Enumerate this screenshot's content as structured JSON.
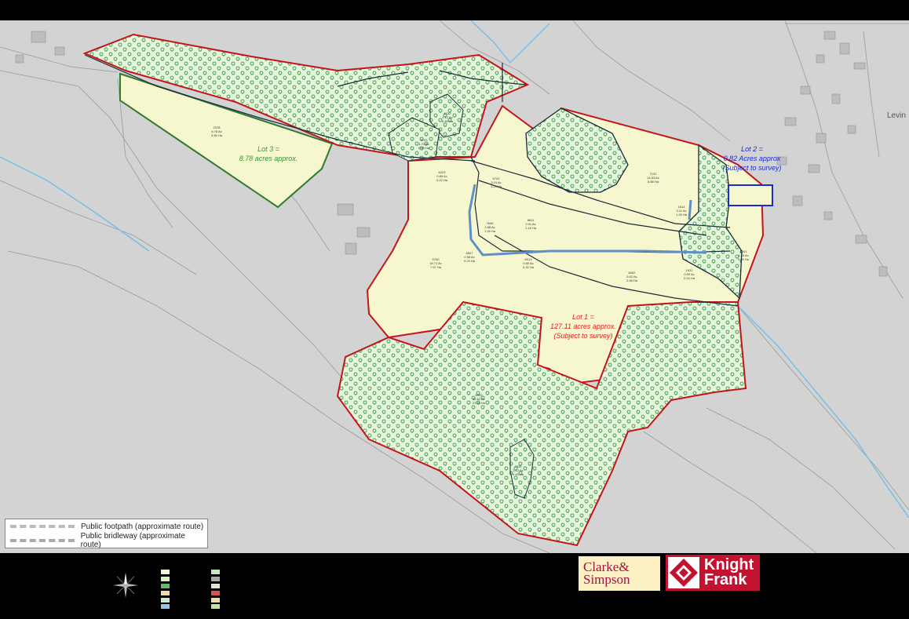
{
  "map": {
    "lots": [
      {
        "name": "lot-1",
        "title": "Lot 1 =",
        "line1": "127.11 acres approx.",
        "line2": "(Subject to survey)",
        "color": "#e0201c"
      },
      {
        "name": "lot-2",
        "title": "Lot 2 =",
        "line1": "0.82 Acres approx",
        "line2": "(Subject to survey)",
        "color": "#1a2bd6"
      },
      {
        "name": "lot-3",
        "title": "Lot 3 =",
        "line1": "8.78 acres approx.",
        "line2": "",
        "color": "#2e9a2e"
      }
    ],
    "plots": [
      {
        "id": "2078",
        "ac": "8.78 Ac",
        "ha": "3.55 Ha"
      },
      {
        "id": "5132",
        "ac": "1.12 Ac",
        "ha": "0.45 Ha"
      },
      {
        "id": "7132",
        "ac": "14.53 Ac",
        "ha": "5.88 Ha"
      },
      {
        "id": "5720",
        "ac": "3.19 Ac",
        "ha": "1.29 Ha"
      },
      {
        "id": "9703",
        "ac": "1.70 Ac",
        "ha": "0.69 Ha"
      },
      {
        "id": "6223",
        "ac": "0.55 Ac",
        "ha": "0.22 Ha"
      },
      {
        "id": "7606",
        "ac": "2.88 Ac",
        "ha": "1.16 Ha"
      },
      {
        "id": "6811",
        "ac": "2.91 Ac",
        "ha": "1.18 Ha"
      },
      {
        "id": "5700",
        "ac": "18.71 Ac",
        "ha": "7.57 Ha"
      },
      {
        "id": "6607",
        "ac": "0.58 Ac",
        "ha": "0.23 Ha"
      },
      {
        "id": "6013",
        "ac": "0.80 Ac",
        "ha": "0.32 Ha"
      },
      {
        "id": "8402",
        "ac": "6.62 Ac",
        "ha": "2.68 Ha"
      },
      {
        "id": "1922",
        "ac": "0.59 Ac",
        "ha": "0.24 Ha"
      },
      {
        "id": "1614",
        "ac": "3.11 Ac",
        "ha": "1.26 Ha"
      },
      {
        "id": "1601",
        "ac": "1.45 Ac",
        "ha": "0.59 Ha"
      },
      {
        "id": "7608",
        "ac": "1.12 Ac",
        "ha": "0.45 Ha"
      },
      {
        "id": "6000",
        "ac": "52.62 Ac",
        "ha": "21.30 Ha"
      }
    ],
    "edge_text": "Levin"
  },
  "legend": {
    "footpath": "Public footpath (approximate route)",
    "bridleway": "Public bridleway (approximate route)"
  },
  "logos": {
    "clarke_line1": "Clarke&",
    "clarke_line2": "Simpson",
    "knight_line1": "Knight",
    "knight_line2": "Frank"
  },
  "colors": {
    "land": "#f7f7cf",
    "woodland": "#e5f6dc",
    "tree_symbol": "#1e8a2c",
    "boundary": "#c4141b",
    "water": "#9cc4e4",
    "background_map": "#d3d3d3"
  }
}
